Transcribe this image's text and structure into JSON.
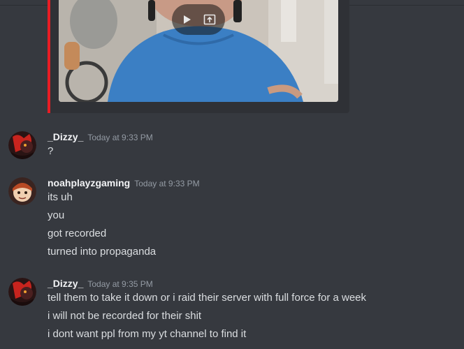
{
  "embed": {
    "accent_color": "#e91c24",
    "controls": [
      {
        "icon": "play-icon"
      },
      {
        "icon": "open-external-icon"
      }
    ]
  },
  "messages": [
    {
      "username": "_Dizzy_",
      "timestamp": "Today at 9:33 PM",
      "avatar": "dizzy-avatar",
      "lines": [
        "?"
      ]
    },
    {
      "username": "noahplayzgaming",
      "timestamp": "Today at 9:33 PM",
      "avatar": "noah-avatar",
      "lines": [
        "its uh",
        "you",
        "got recorded",
        "turned into propaganda"
      ]
    },
    {
      "username": "_Dizzy_",
      "timestamp": "Today at 9:35 PM",
      "avatar": "dizzy-avatar",
      "lines": [
        "tell them to take it down or i raid their server with full force for a week",
        "i will not be recorded for their shit",
        "i dont want ppl from my yt channel to find it"
      ]
    }
  ]
}
